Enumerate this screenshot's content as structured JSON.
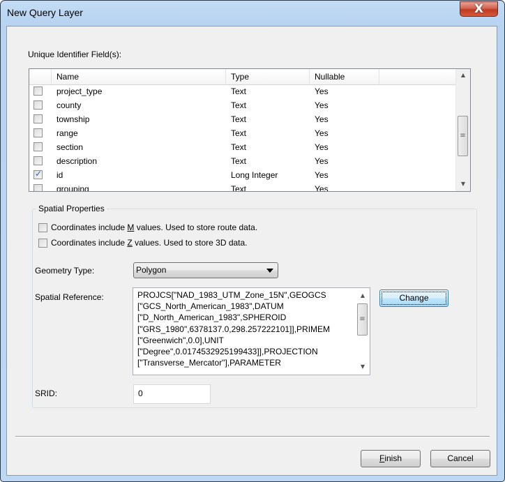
{
  "window": {
    "title": "New Query Layer",
    "close_glyph": "X"
  },
  "unique_id": {
    "label": "Unique Identifier Field(s):",
    "columns": [
      "Name",
      "Type",
      "Nullable"
    ],
    "rows": [
      {
        "checked": false,
        "name": "project_type",
        "type": "Text",
        "nullable": "Yes"
      },
      {
        "checked": false,
        "name": "county",
        "type": "Text",
        "nullable": "Yes"
      },
      {
        "checked": false,
        "name": "township",
        "type": "Text",
        "nullable": "Yes"
      },
      {
        "checked": false,
        "name": "range",
        "type": "Text",
        "nullable": "Yes"
      },
      {
        "checked": false,
        "name": "section",
        "type": "Text",
        "nullable": "Yes"
      },
      {
        "checked": false,
        "name": "description",
        "type": "Text",
        "nullable": "Yes"
      },
      {
        "checked": true,
        "name": "id",
        "type": "Long Integer",
        "nullable": "Yes"
      },
      {
        "checked": false,
        "name": "grouping",
        "type": "Text",
        "nullable": "Yes"
      }
    ]
  },
  "spatial": {
    "title": "Spatial Properties",
    "m_values": {
      "pre": "Coordinates include ",
      "key": "M",
      "post": " values. Used to store route data.",
      "checked": false
    },
    "z_values": {
      "pre": "Coordinates include ",
      "key": "Z",
      "post": " values. Used to store 3D data.",
      "checked": false
    },
    "geometry_label": "Geometry Type:",
    "geometry_value": "Polygon",
    "sr_label": "Spatial Reference:",
    "sr_text": "PROJCS[\"NAD_1983_UTM_Zone_15N\",GEOGCS\n[\"GCS_North_American_1983\",DATUM\n[\"D_North_American_1983\",SPHEROID\n[\"GRS_1980\",6378137.0,298.257222101]],PRIMEM\n[\"Greenwich\",0.0],UNIT\n[\"Degree\",0.0174532925199433]],PROJECTION\n[\"Transverse_Mercator\"],PARAMETER",
    "change_label": "Change",
    "srid_label": "SRID:",
    "srid_value": "0"
  },
  "footer": {
    "finish_key": "F",
    "finish_rest": "inish",
    "cancel_label": "Cancel"
  }
}
